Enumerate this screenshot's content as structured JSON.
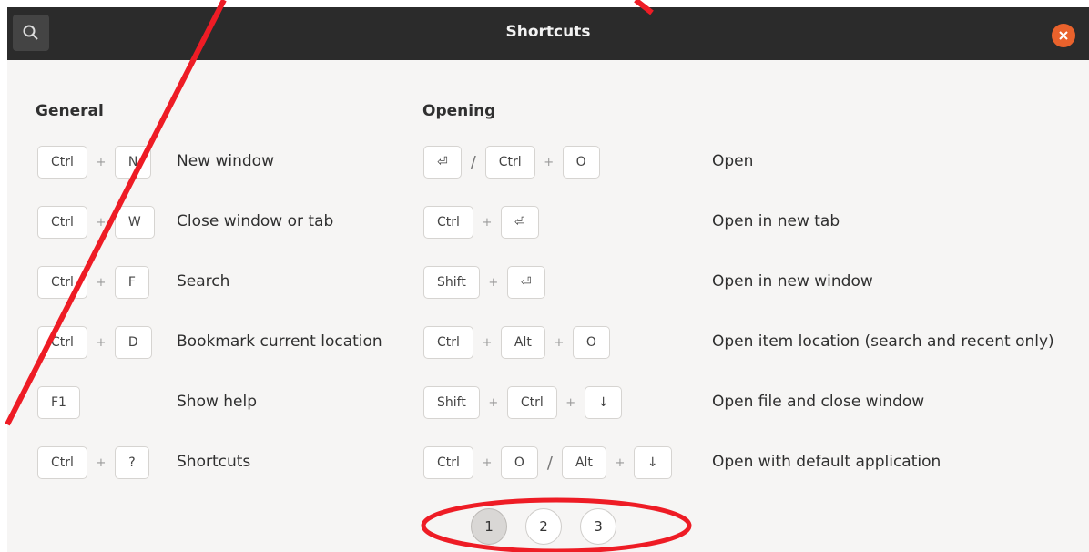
{
  "window": {
    "title": "Shortcuts"
  },
  "general": {
    "title": "General",
    "rows": [
      {
        "keys": [
          "Ctrl",
          "+",
          "N"
        ],
        "label": "New window"
      },
      {
        "keys": [
          "Ctrl",
          "+",
          "W"
        ],
        "label": "Close window or tab"
      },
      {
        "keys": [
          "Ctrl",
          "+",
          "F"
        ],
        "label": "Search"
      },
      {
        "keys": [
          "Ctrl",
          "+",
          "D"
        ],
        "label": "Bookmark current location"
      },
      {
        "keys": [
          "F1"
        ],
        "label": "Show help"
      },
      {
        "keys": [
          "Ctrl",
          "+",
          "?"
        ],
        "label": "Shortcuts"
      }
    ]
  },
  "opening": {
    "title": "Opening",
    "rows": [
      {
        "keys": [
          "⏎",
          "/",
          "Ctrl",
          "+",
          "O"
        ],
        "label": "Open"
      },
      {
        "keys": [
          "Ctrl",
          "+",
          "⏎"
        ],
        "label": "Open in new tab"
      },
      {
        "keys": [
          "Shift",
          "+",
          "⏎"
        ],
        "label": "Open in new window"
      },
      {
        "keys": [
          "Ctrl",
          "+",
          "Alt",
          "+",
          "O"
        ],
        "label": "Open item location (search and recent only)"
      },
      {
        "keys": [
          "Shift",
          "+",
          "Ctrl",
          "+",
          "↓"
        ],
        "label": "Open file and close window"
      },
      {
        "keys": [
          "Ctrl",
          "+",
          "O",
          "/",
          "Alt",
          "+",
          "↓"
        ],
        "label": "Open with default application"
      }
    ]
  },
  "pagination": {
    "pages": [
      "1",
      "2",
      "3"
    ],
    "current": "1"
  },
  "icons": {
    "search": "search-icon",
    "close": "close-icon"
  },
  "colors": {
    "titlebar": "#2b2b2b",
    "close_button": "#e9622c",
    "annotation": "#ee1c25"
  }
}
